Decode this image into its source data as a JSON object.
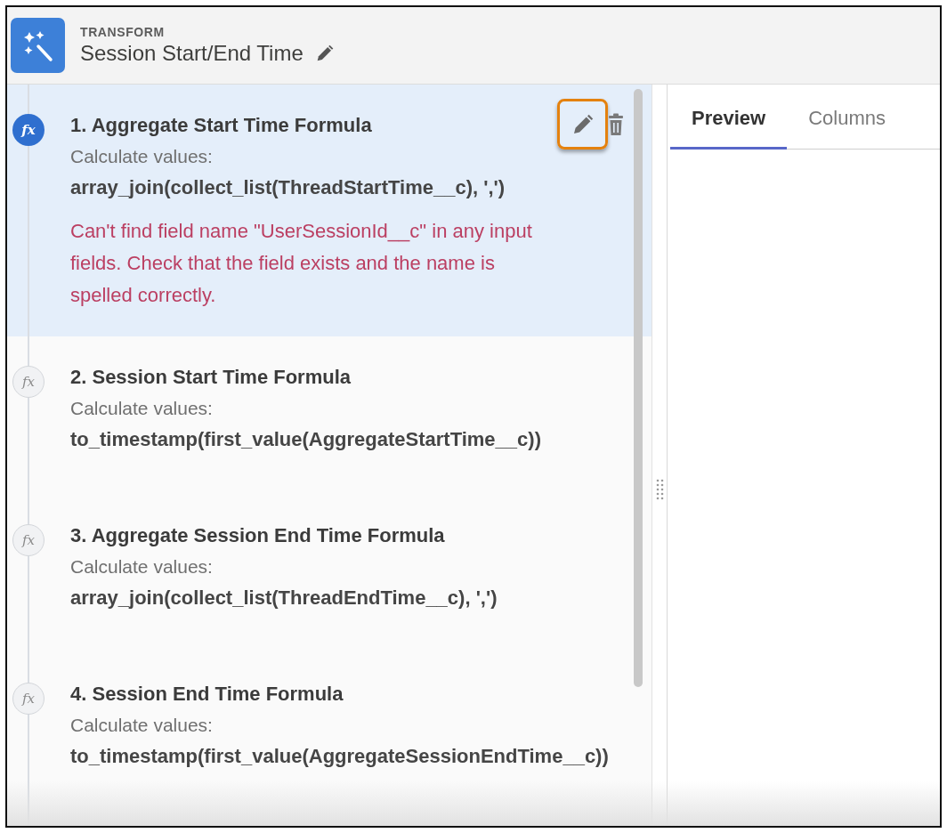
{
  "header": {
    "type_label": "TRANSFORM",
    "title": "Session Start/End Time"
  },
  "steps": [
    {
      "icon": "fx",
      "title": "1. Aggregate Start Time Formula",
      "description": "Calculate values:",
      "formula": "array_join(collect_list(ThreadStartTime__c), ',')",
      "error": "Can't find field name \"UserSessionId__c\" in any input fields. Check that the field exists and the name is spelled correctly.",
      "selected": true,
      "actions": {
        "edit_highlighted": true
      }
    },
    {
      "icon": "fx",
      "title": "2. Session Start Time Formula",
      "description": "Calculate values:",
      "formula": "to_timestamp(first_value(AggregateStartTime__c))",
      "selected": false
    },
    {
      "icon": "fx",
      "title": "3. Aggregate Session End Time Formula",
      "description": "Calculate values:",
      "formula": "array_join(collect_list(ThreadEndTime__c), ',')",
      "selected": false
    },
    {
      "icon": "fx",
      "title": "4. Session End Time Formula",
      "description": "Calculate values:",
      "formula": "to_timestamp(first_value(AggregateSessionEndTime__c))",
      "selected": false
    }
  ],
  "tabs": [
    {
      "label": "Preview",
      "selected": true
    },
    {
      "label": "Columns",
      "selected": false
    }
  ]
}
